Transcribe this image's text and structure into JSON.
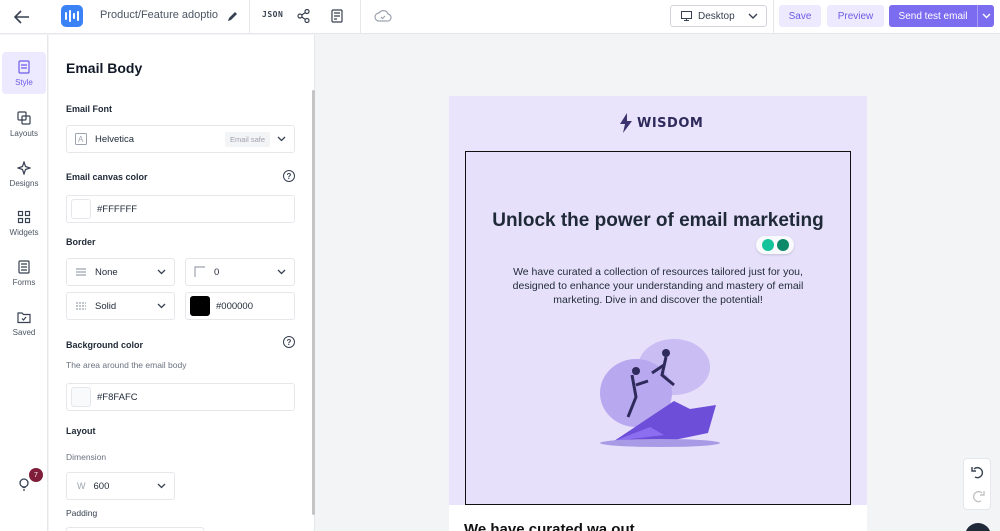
{
  "topbar": {
    "doc_title": "Product/Feature adoptio",
    "json_label": "JSON",
    "device": "Desktop",
    "save_label": "Save",
    "preview_label": "Preview",
    "send_label": "Send test email"
  },
  "rail": {
    "items": [
      {
        "label": "Style",
        "icon": "style-icon"
      },
      {
        "label": "Layouts",
        "icon": "layouts-icon"
      },
      {
        "label": "Designs",
        "icon": "designs-icon"
      },
      {
        "label": "Widgets",
        "icon": "widgets-icon"
      },
      {
        "label": "Forms",
        "icon": "forms-icon"
      },
      {
        "label": "Saved",
        "icon": "saved-icon"
      }
    ],
    "notification_count": "7"
  },
  "panel": {
    "title": "Email Body",
    "email_font_label": "Email Font",
    "email_font_value": "Helvetica",
    "email_safe_badge": "Email safe",
    "canvas_color_label": "Email canvas color",
    "canvas_color_value": "#FFFFFF",
    "border_label": "Border",
    "border_type": "None",
    "border_width": "0",
    "border_style": "Solid",
    "border_color": "#000000",
    "bg_color_label": "Background color",
    "bg_color_sub": "The area around the email body",
    "bg_color_value": "#F8FAFC",
    "layout_label": "Layout",
    "dimension_label": "Dimension",
    "dimension_prefix": "W",
    "dimension_value": "600",
    "padding_label": "Padding"
  },
  "email": {
    "brand": "WISDOM",
    "hero_title": "Unlock the power of email marketing",
    "hero_text": "We have curated a collection of resources tailored just for you, designed to enhance your understanding and mastery of email marketing. Dive in and discover the potential!",
    "below_text": "We have curated wa out"
  },
  "colors": {
    "accent": "#7c6cf0",
    "accent_light": "#ede9fe",
    "email_bg": "#e9e4fb"
  }
}
